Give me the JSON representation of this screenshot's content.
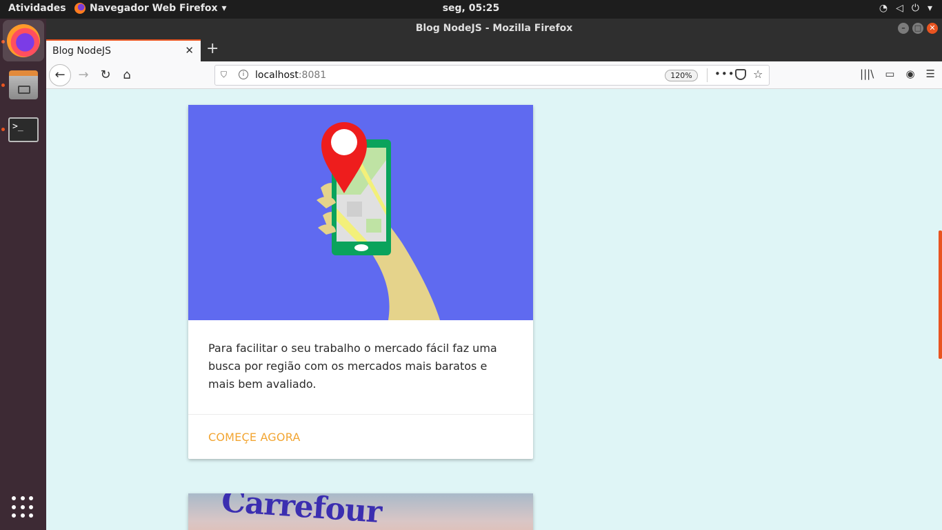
{
  "topbar": {
    "activities": "Atividades",
    "app_menu": "Navegador Web Firefox",
    "clock": "seg, 05:25"
  },
  "dock": {
    "items": [
      "firefox-icon",
      "files-icon",
      "terminal-icon",
      "show-apps-icon"
    ]
  },
  "window": {
    "title": "Blog NodeJS - Mozilla Firefox"
  },
  "tab": {
    "title": "Blog NodeJS",
    "close": "✕",
    "new_tab": "+"
  },
  "navbar": {
    "url_host": "localhost",
    "url_port": ":8081",
    "zoom": "120%",
    "more": "•••"
  },
  "card": {
    "text": "Para facilitar o seu trabalho o mercado fácil faz uma busca por região com os mercados mais baratos e mais bem avaliado.",
    "action": "COMEÇE AGORA",
    "image_bg": "#5f6af0"
  },
  "card2": {
    "sign_text": "Carrefour"
  },
  "colors": {
    "accent": "#e95420",
    "page_bg": "#dff5f6",
    "action": "#f2a532"
  }
}
